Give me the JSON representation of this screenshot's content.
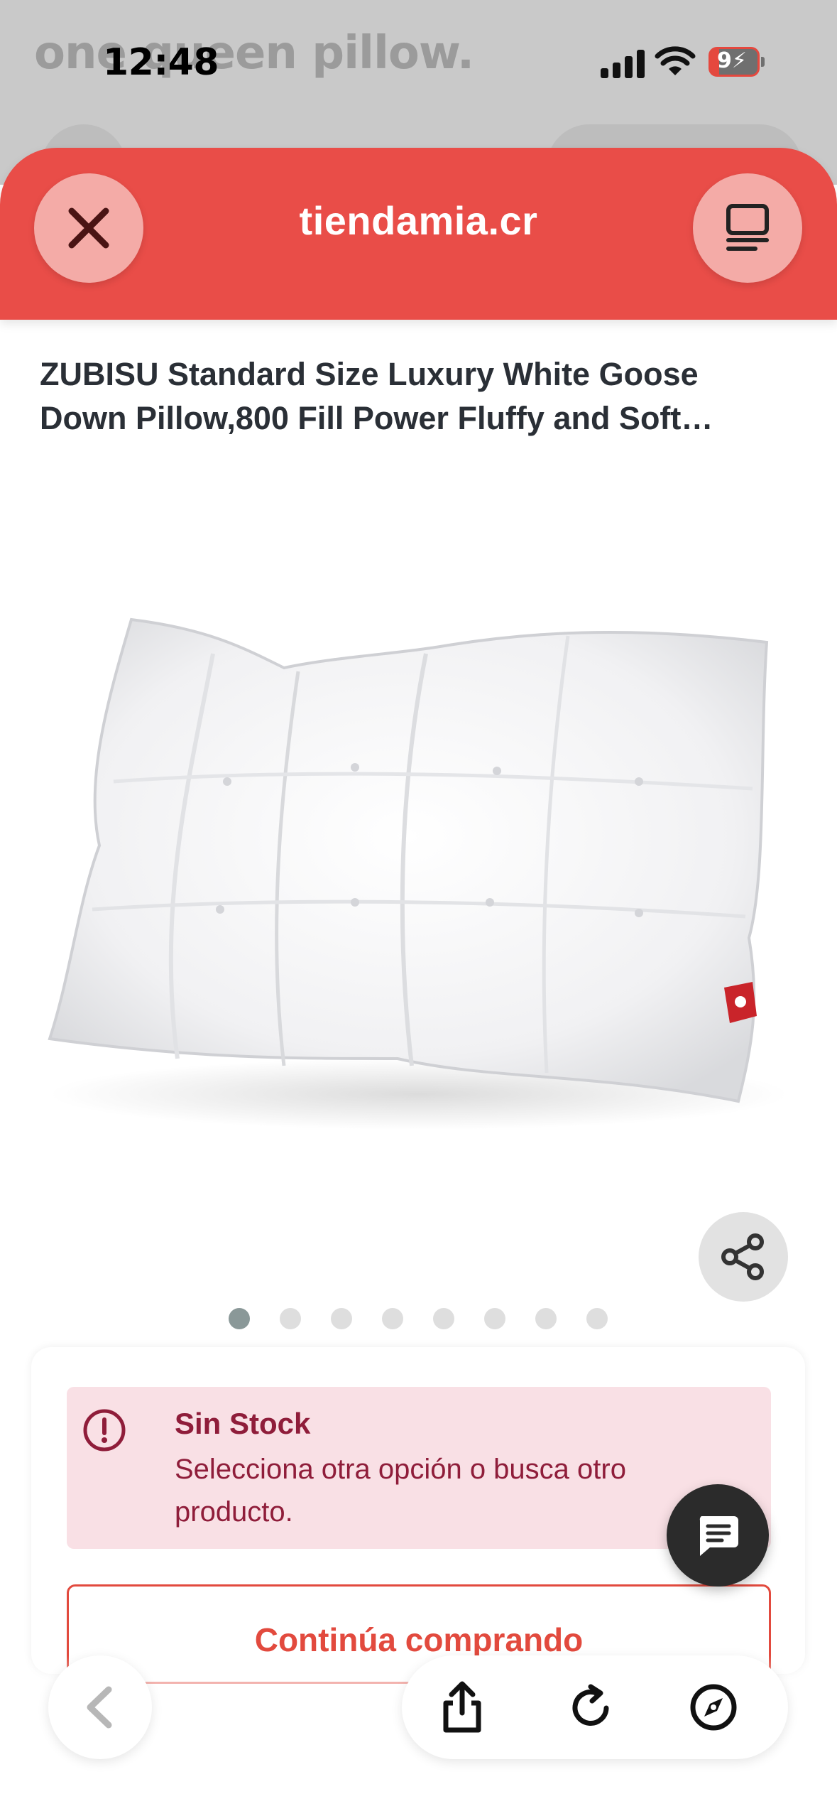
{
  "background_page": {
    "heading_fragment": "one queen pillow."
  },
  "status_bar": {
    "time": "12:48",
    "battery": "9"
  },
  "header": {
    "title": "tiendamia.cr",
    "close_icon": "close-icon",
    "tabs_icon": "tabs-icon",
    "accent_color": "#e94d48"
  },
  "product": {
    "title": "ZUBISU Standard Size Luxury White Goose Down Pillow,800 Fill Power Fluffy and Soft…",
    "image_alt": "white-tufted-down-pillow",
    "carousel": {
      "total": 8,
      "active": 0
    }
  },
  "stock": {
    "title": "Sin Stock",
    "message": "Selecciona otra opción o busca otro producto.",
    "alert_color": "#8f1d3a",
    "alert_bg": "#f9e0e5"
  },
  "actions": {
    "continue_label": "Continúa comprando"
  },
  "toolbar": {
    "back_icon": "chevron-left-icon",
    "share_icon": "share-icon",
    "reload_icon": "reload-icon",
    "compass_icon": "compass-icon"
  }
}
